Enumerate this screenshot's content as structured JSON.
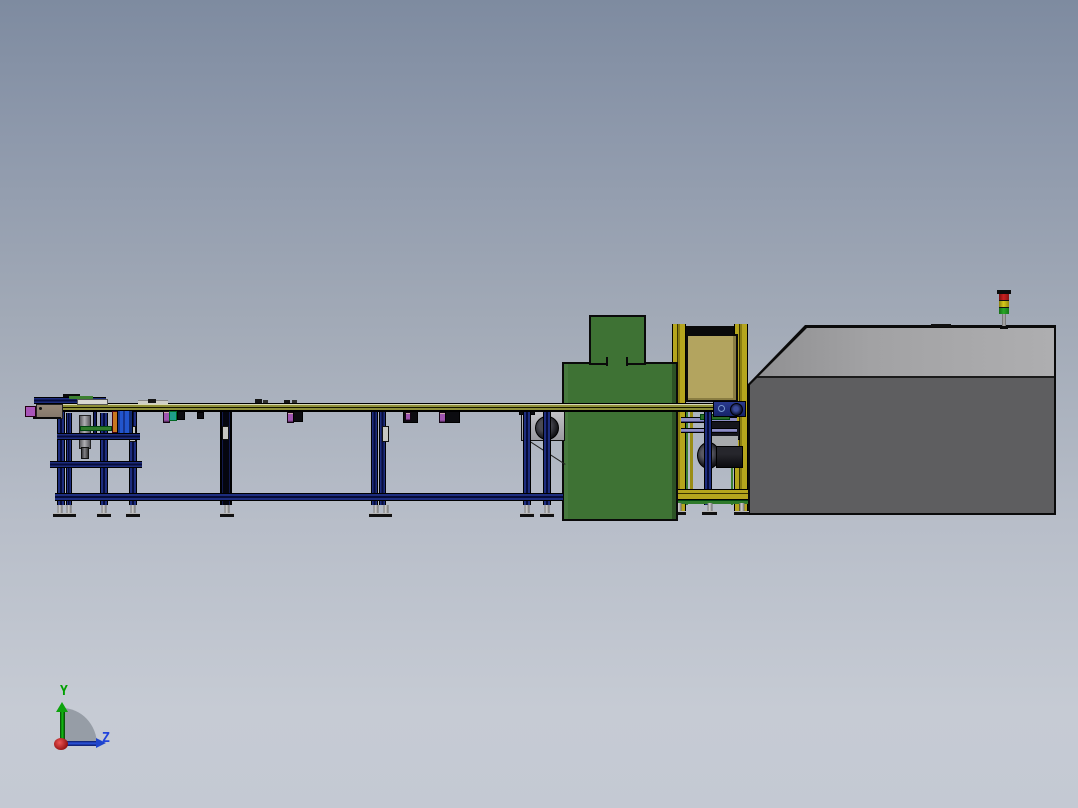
{
  "scene": {
    "description_tag": "cad-3d-viewport-side-view",
    "axis_triad": {
      "y_label": "Y",
      "z_label": "Z"
    },
    "colors": {
      "background_top": "#7e8ba0",
      "background_bottom": "#c6cbd4",
      "frame_navy": "#1d2d7e",
      "rail_olive": "#8f9038",
      "machine_green": "#3e7234",
      "panel_tan": "#b3a45f",
      "frame_yellow": "#b5a51d",
      "enclosure_dark_gray": "#5e5e60",
      "enclosure_light_gray": "#a2a2a4",
      "tower_red": "#cc2020",
      "tower_yellow": "#d6ca1a",
      "tower_green": "#28a828",
      "axis_y_green": "#00a000",
      "axis_z_blue": "#2244dd",
      "axis_x_red": "#cc2020"
    }
  }
}
